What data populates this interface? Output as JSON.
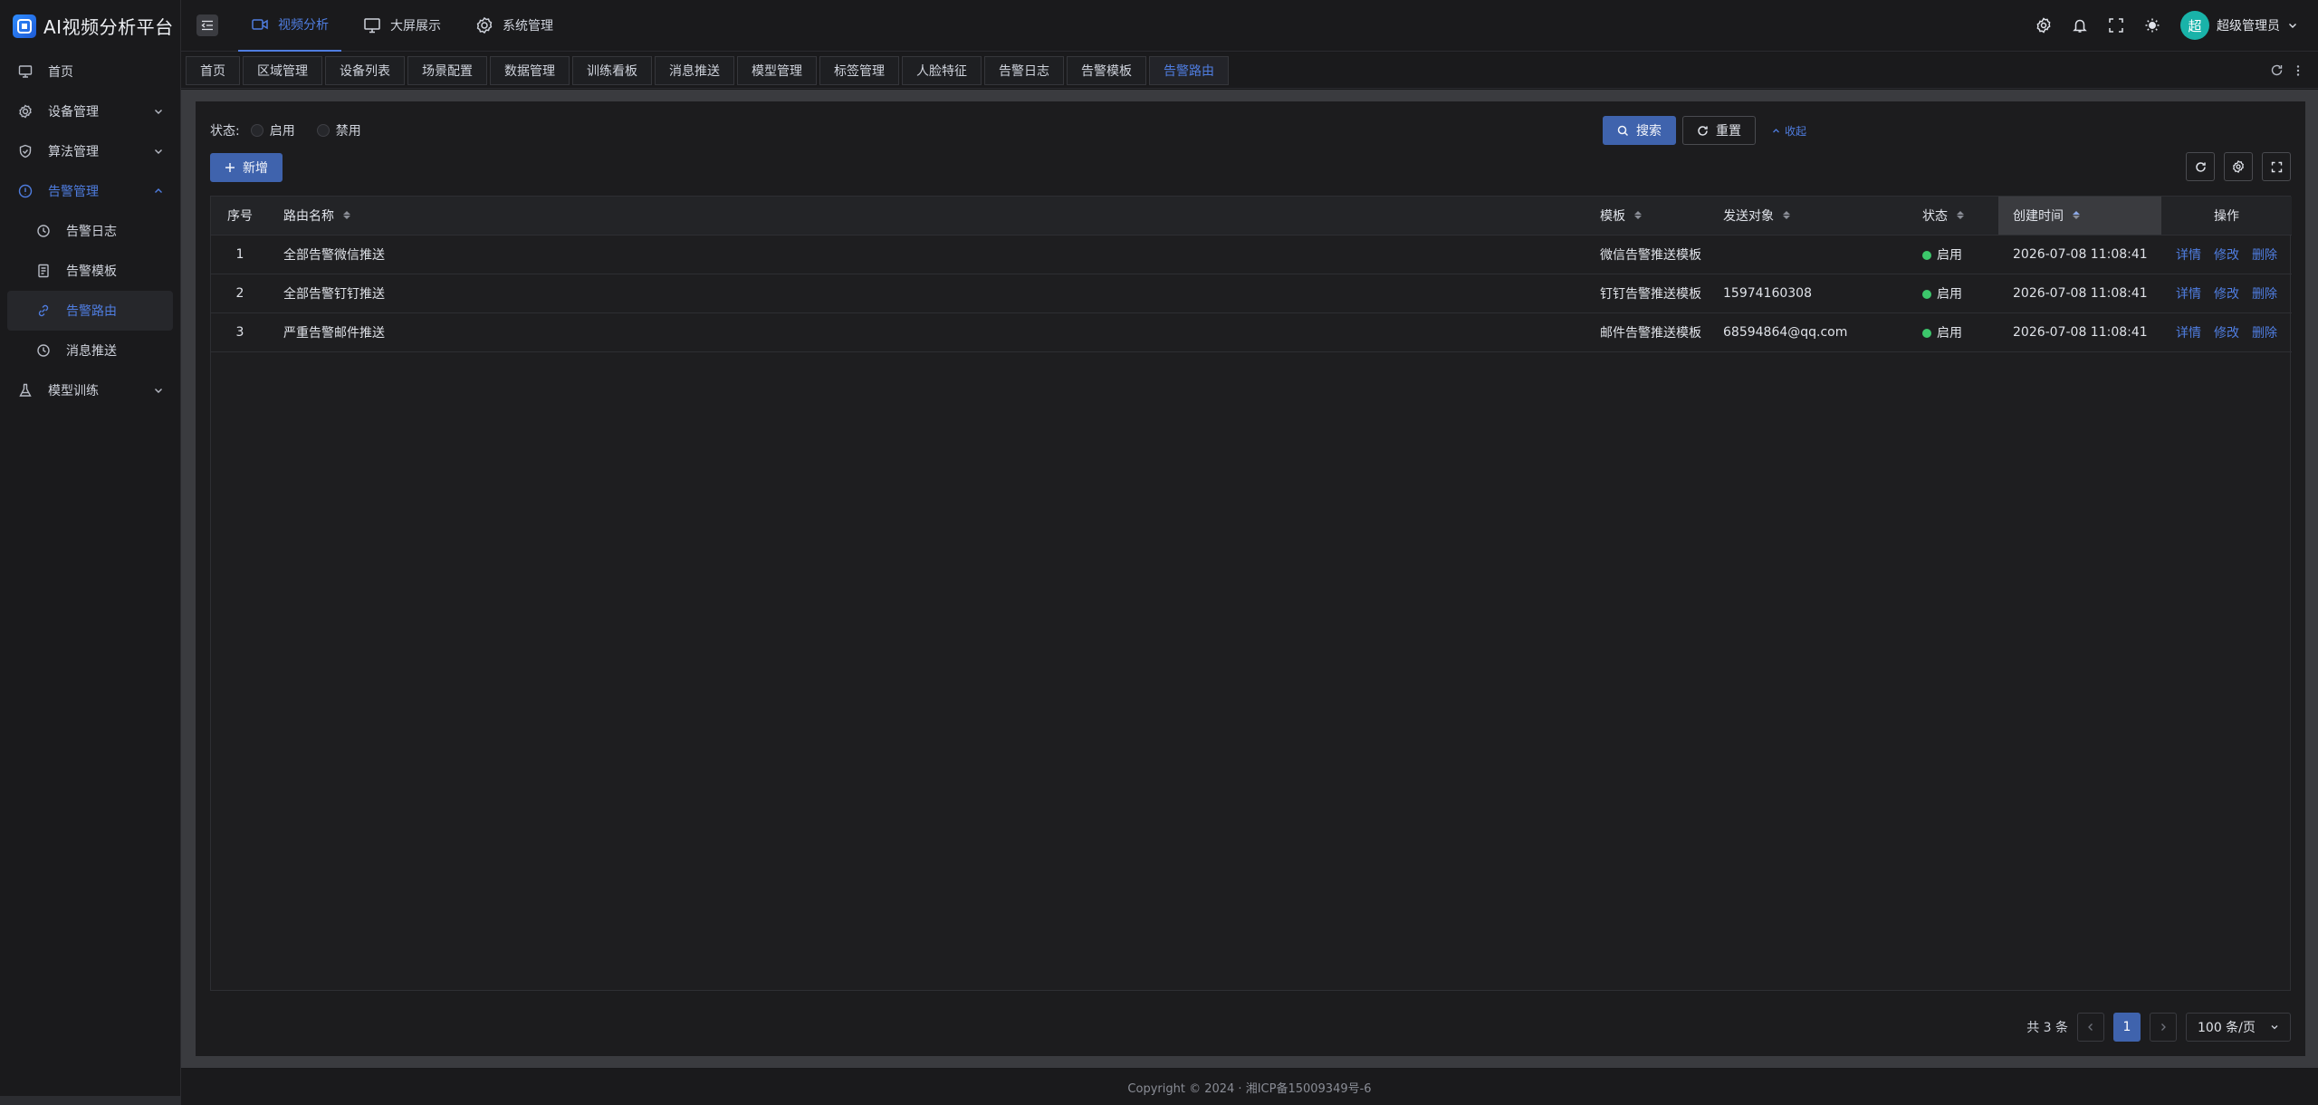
{
  "app": {
    "title": "AI视频分析平台",
    "logo_icon": "app-logo-icon"
  },
  "sidebar": {
    "items": [
      {
        "label": "首页",
        "icon": "monitor-icon"
      },
      {
        "label": "设备管理",
        "icon": "gear-icon"
      },
      {
        "label": "算法管理",
        "icon": "shield-icon"
      },
      {
        "label": "告警管理",
        "icon": "alert-icon",
        "expanded": true,
        "children": [
          {
            "label": "告警日志",
            "icon": "history-icon"
          },
          {
            "label": "告警模板",
            "icon": "document-icon"
          },
          {
            "label": "告警路由",
            "icon": "link-icon",
            "selected": true
          },
          {
            "label": "消息推送",
            "icon": "history-icon"
          }
        ]
      },
      {
        "label": "模型训练",
        "icon": "flask-icon"
      }
    ]
  },
  "header": {
    "nav": [
      {
        "label": "视频分析",
        "icon": "video-camera-icon",
        "active": true
      },
      {
        "label": "大屏展示",
        "icon": "monitor-icon"
      },
      {
        "label": "系统管理",
        "icon": "gear-icon"
      }
    ],
    "user_name": "超级管理员",
    "avatar_text": "超"
  },
  "tabs": [
    "首页",
    "区域管理",
    "设备列表",
    "场景配置",
    "数据管理",
    "训练看板",
    "消息推送",
    "模型管理",
    "标签管理",
    "人脸特征",
    "告警日志",
    "告警模板",
    "告警路由"
  ],
  "active_tab": "告警路由",
  "filter": {
    "status_label": "状态:",
    "options": [
      "启用",
      "禁用"
    ],
    "search_label": "搜索",
    "reset_label": "重置",
    "collapse_label": "收起"
  },
  "toolbar": {
    "add_label": "新增"
  },
  "table": {
    "columns": [
      "序号",
      "路由名称",
      "模板",
      "发送对象",
      "状态",
      "创建时间",
      "操作"
    ],
    "rows": [
      {
        "index": "1",
        "name": "全部告警微信推送",
        "template": "微信告警推送模板",
        "target": "",
        "status": "启用",
        "created": "2026-07-08 11:08:41"
      },
      {
        "index": "2",
        "name": "全部告警钉钉推送",
        "template": "钉钉告警推送模板",
        "target": "15974160308",
        "status": "启用",
        "created": "2026-07-08 11:08:41"
      },
      {
        "index": "3",
        "name": "严重告警邮件推送",
        "template": "邮件告警推送模板",
        "target": "68594864@qq.com",
        "status": "启用",
        "created": "2026-07-08 11:08:41"
      }
    ],
    "actions": [
      "详情",
      "修改",
      "删除"
    ],
    "status_color": "#3cc76b"
  },
  "pagination": {
    "total_text": "共 3 条",
    "current_page": "1",
    "page_size": "100 条/页"
  },
  "footer": {
    "copyright": "Copyright © 2024 · 湘ICP备15009349号-6"
  },
  "colors": {
    "accent": "#4f7de0",
    "primary_button": "#3f63ad",
    "avatar": "#19b3a9"
  }
}
